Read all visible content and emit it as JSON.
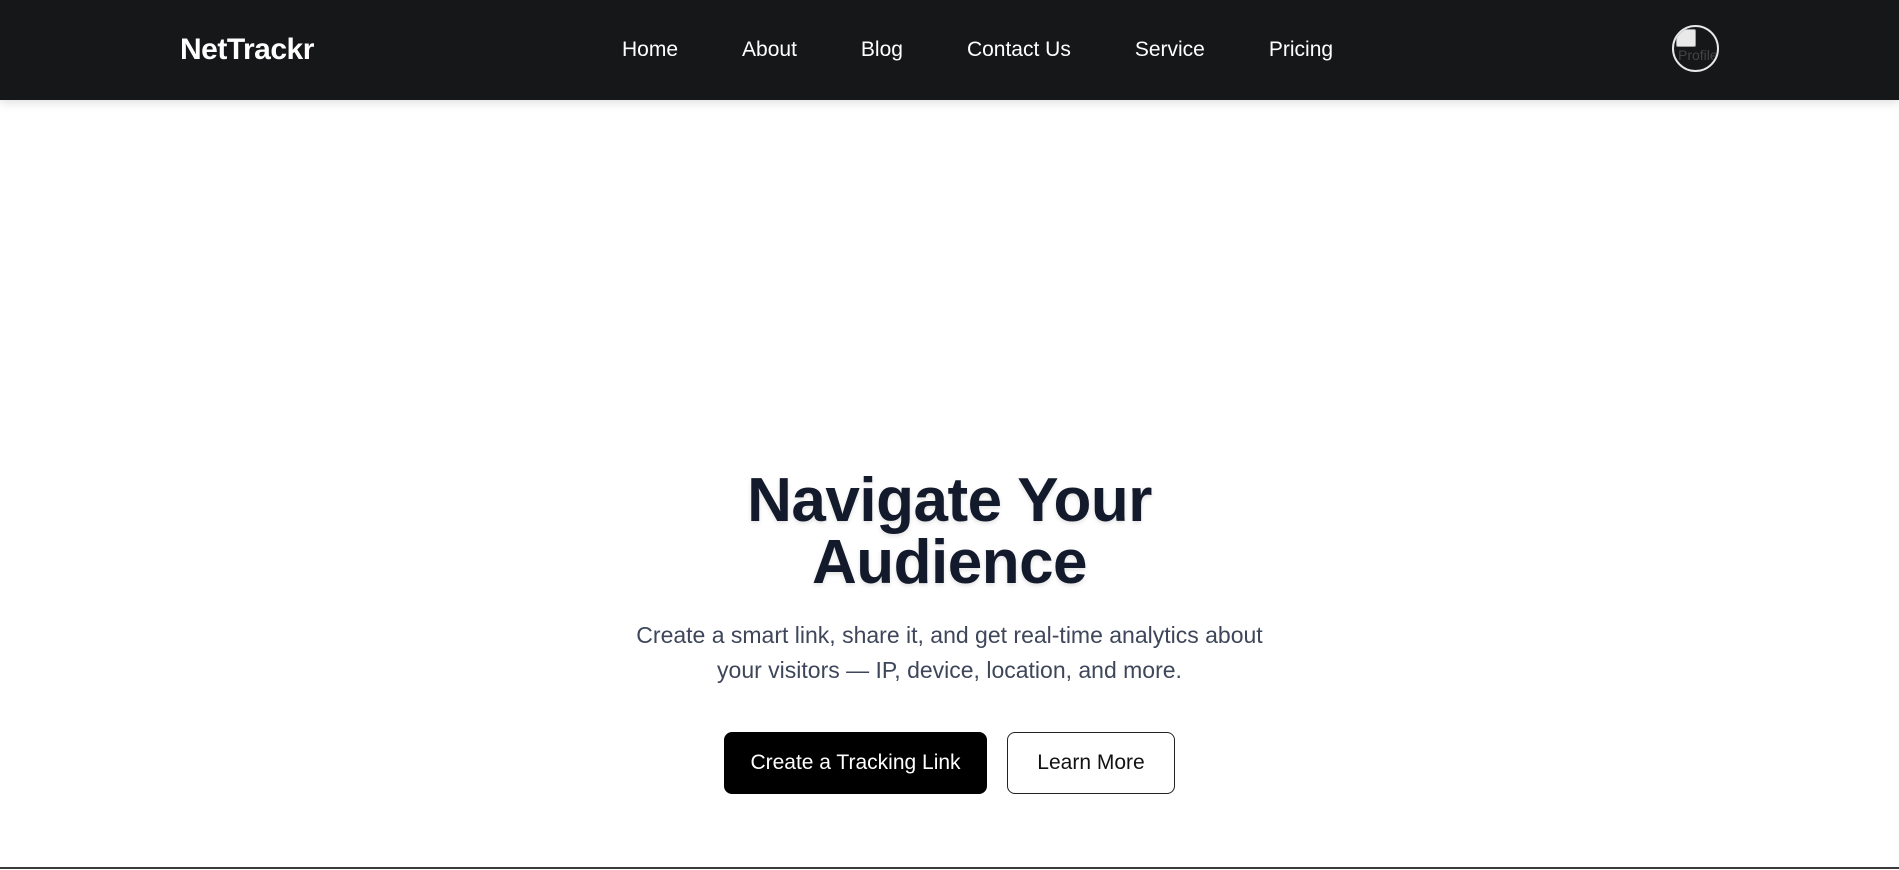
{
  "navbar": {
    "brand": "NetTrackr",
    "links": [
      "Home",
      "About",
      "Blog",
      "Contact Us",
      "Service",
      "Pricing"
    ],
    "avatar_alt": "Profile"
  },
  "hero": {
    "title_line1": "Navigate Your",
    "title_line2": "Audience",
    "subtitle": "Create a smart link, share it, and get real-time analytics about your visitors — IP, device, location, and more.",
    "primary_button": "Create a Tracking Link",
    "secondary_button": "Learn More"
  },
  "colors": {
    "navbar_bg": "#161718",
    "title": "#131a2b",
    "subtitle": "#3e465a",
    "primary_button_bg": "#000000"
  }
}
